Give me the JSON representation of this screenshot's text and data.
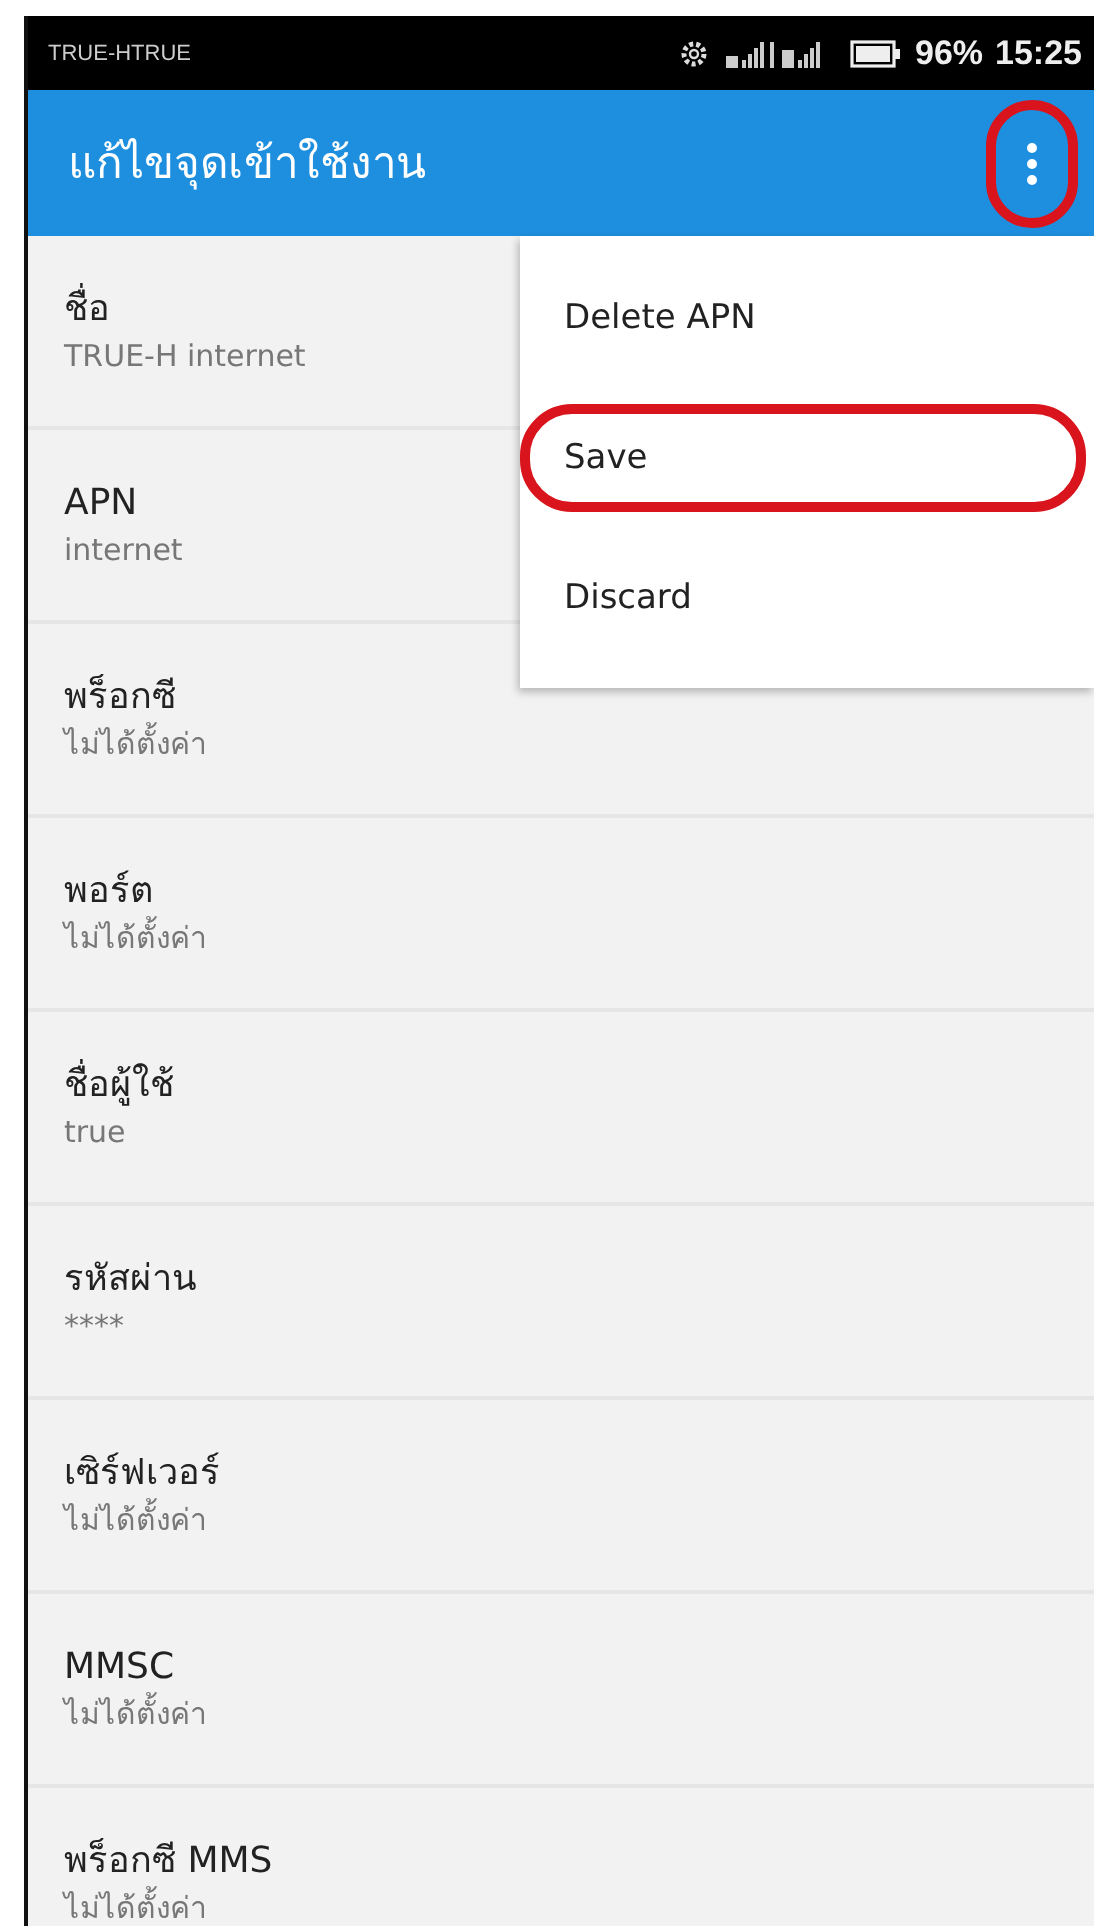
{
  "status_bar": {
    "carrier": "TRUE-HTRUE",
    "battery": "96%",
    "time": "15:25"
  },
  "app_bar": {
    "title": "แก้ไขจุดเข้าใช้งาน",
    "overflow_highlighted": true
  },
  "settings": [
    {
      "label": "ชื่อ",
      "value": "TRUE-H internet"
    },
    {
      "label": "APN",
      "value": "internet"
    },
    {
      "label": "พร็อกซี",
      "value": "ไม่ได้ตั้งค่า"
    },
    {
      "label": "พอร์ต",
      "value": "ไม่ได้ตั้งค่า"
    },
    {
      "label": "ชื่อผู้ใช้",
      "value": "true"
    },
    {
      "label": "รหัสผ่าน",
      "value": "****"
    },
    {
      "label": "เซิร์ฟเวอร์",
      "value": "ไม่ได้ตั้งค่า"
    },
    {
      "label": "MMSC",
      "value": "ไม่ได้ตั้งค่า"
    },
    {
      "label": "พร็อกซี MMS",
      "value": "ไม่ได้ตั้งค่า"
    }
  ],
  "menu": [
    {
      "label": "Delete APN",
      "highlighted": false
    },
    {
      "label": "Save",
      "highlighted": true
    },
    {
      "label": "Discard",
      "highlighted": false
    }
  ]
}
